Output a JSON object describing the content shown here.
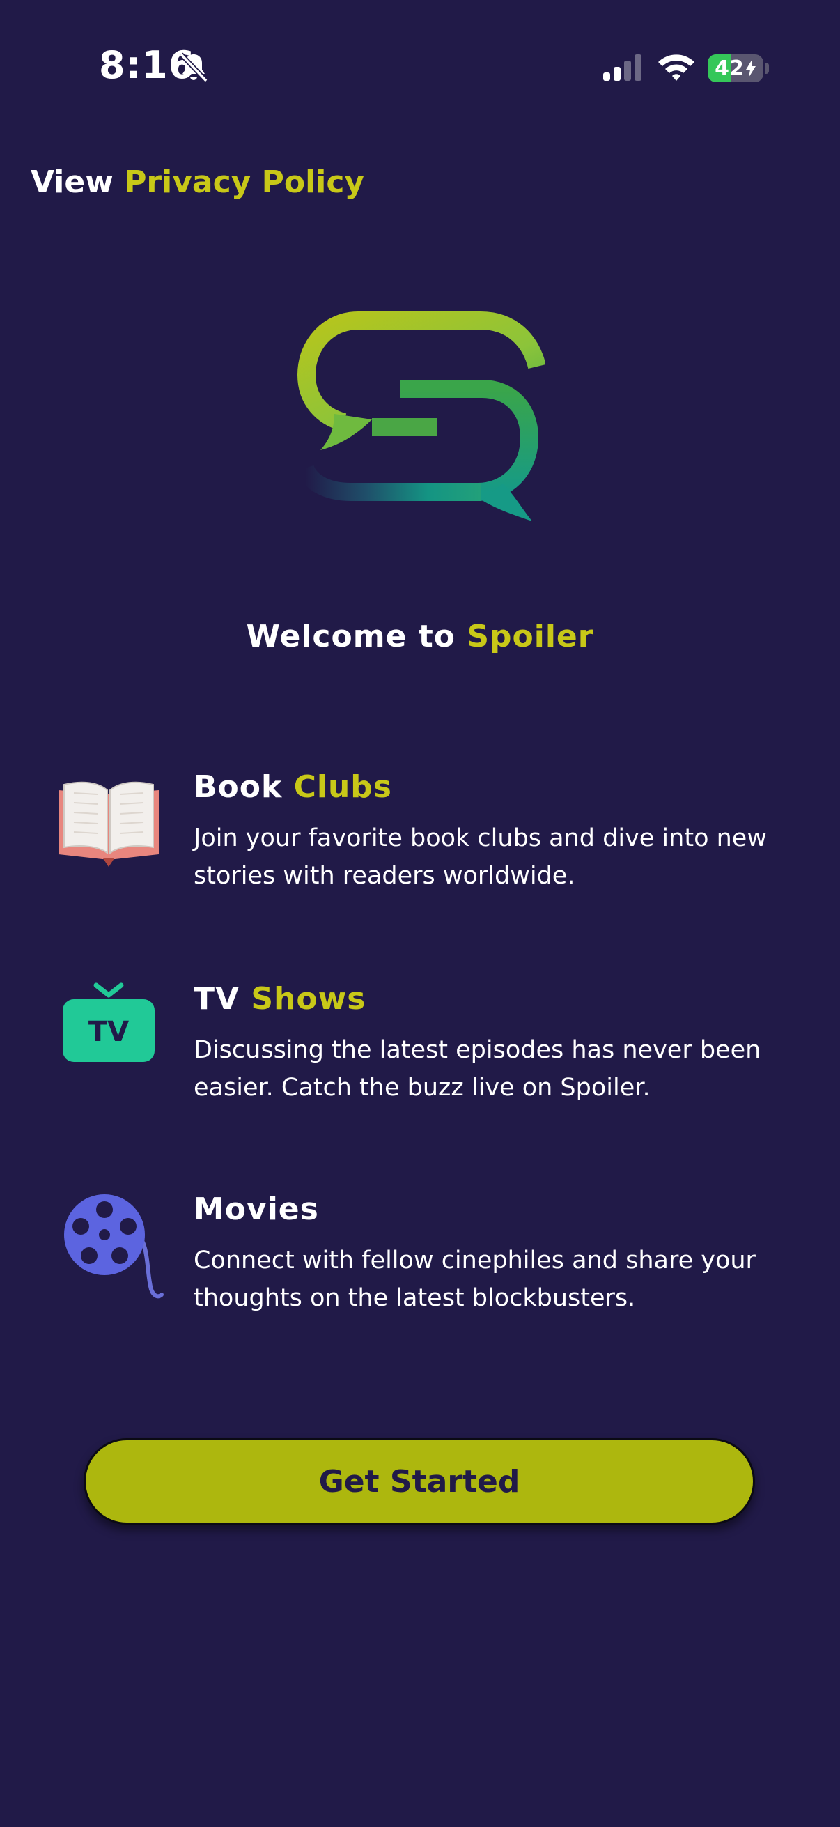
{
  "status_bar": {
    "time": "8:16",
    "battery_percent": "42",
    "battery_level": 0.42,
    "icons": [
      "bell-slash-icon",
      "signal-icon",
      "wifi-icon",
      "battery-charging-icon"
    ]
  },
  "header": {
    "privacy_prefix": "View",
    "privacy_link": "Privacy Policy"
  },
  "logo": {
    "name": "spoiler-logo-icon"
  },
  "welcome": {
    "prefix": "Welcome to",
    "brand": "Spoiler"
  },
  "features": [
    {
      "icon": "open-book-icon",
      "title_plain": "Book",
      "title_accent": "Clubs",
      "description": "Join your favorite book clubs and dive into new stories with readers worldwide."
    },
    {
      "icon": "tv-icon",
      "title_plain": "TV",
      "title_accent": "Shows",
      "description": "Discussing the latest episodes has never been easier. Catch the buzz live on Spoiler."
    },
    {
      "icon": "film-reel-icon",
      "title_plain": "Movies",
      "title_accent": "",
      "description": "Connect with fellow cinephiles and share your thoughts on the latest blockbusters."
    }
  ],
  "cta": {
    "label": "Get Started"
  },
  "colors": {
    "background": "#211a48",
    "accent": "#c8c818",
    "button": "#adb70e",
    "text": "#ffffff"
  }
}
